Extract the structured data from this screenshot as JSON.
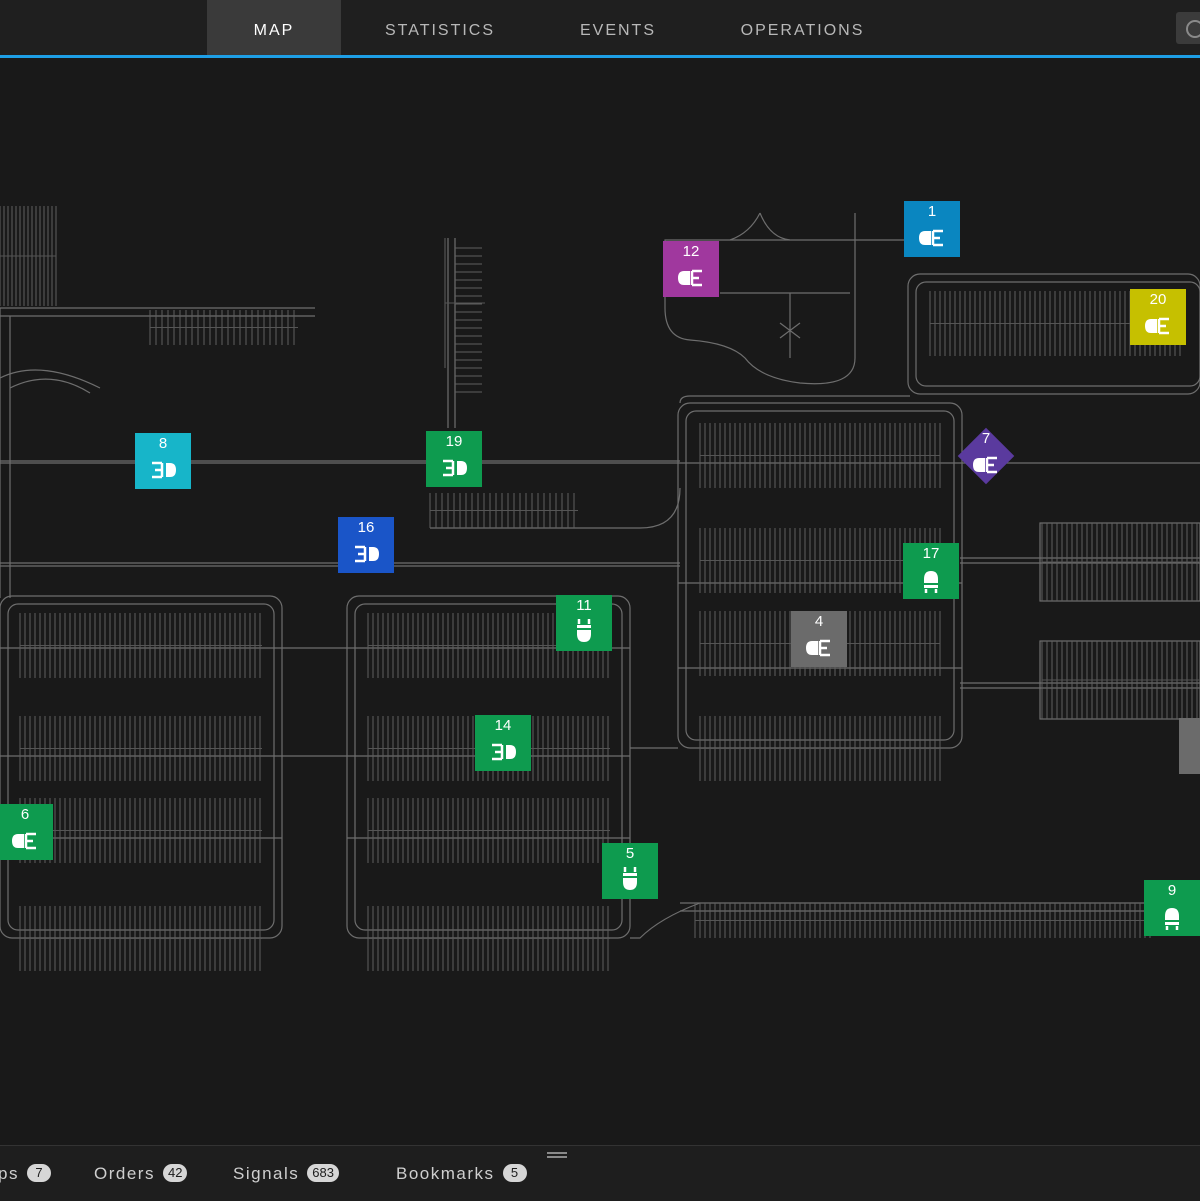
{
  "tabs": [
    {
      "label": "MAP",
      "active": true
    },
    {
      "label": "STATISTICS",
      "active": false
    },
    {
      "label": "EVENTS",
      "active": false
    },
    {
      "label": "OPERATIONS",
      "active": false
    }
  ],
  "colors": {
    "accent": "#1e9fe6",
    "green": "#0e9b4f",
    "cyan": "#17b5c9",
    "teal_blue": "#0a86c0",
    "blue": "#1a55c8",
    "magenta": "#a0389e",
    "yellow": "#c6c000",
    "purple": "#5a3a9e",
    "gray": "#6b6b6b"
  },
  "vehicles": [
    {
      "number": "1",
      "color": "#0a86c0",
      "icon": "agv-forward-icon"
    },
    {
      "number": "12",
      "color": "#a0389e",
      "icon": "agv-forward-icon"
    },
    {
      "number": "20",
      "color": "#c6c000",
      "icon": "agv-forward-icon"
    },
    {
      "number": "8",
      "color": "#17b5c9",
      "icon": "agv-reverse-icon"
    },
    {
      "number": "19",
      "color": "#0e9b4f",
      "icon": "agv-reverse-icon"
    },
    {
      "number": "7",
      "color": "#5a3a9e",
      "icon": "agv-forward-icon"
    },
    {
      "number": "16",
      "color": "#1a55c8",
      "icon": "agv-reverse-icon"
    },
    {
      "number": "17",
      "color": "#0e9b4f",
      "icon": "agv-up-icon"
    },
    {
      "number": "11",
      "color": "#0e9b4f",
      "icon": "agv-down-icon"
    },
    {
      "number": "4",
      "color": "#6b6b6b",
      "icon": "agv-forward-icon"
    },
    {
      "number": "14",
      "color": "#0e9b4f",
      "icon": "agv-reverse-icon"
    },
    {
      "number": "6",
      "color": "#0e9b4f",
      "icon": "agv-forward-icon"
    },
    {
      "number": "5",
      "color": "#0e9b4f",
      "icon": "agv-down-icon"
    },
    {
      "number": "9",
      "color": "#0e9b4f",
      "icon": "agv-up-icon"
    }
  ],
  "bottom_tabs": [
    {
      "label": "ps",
      "count": "7"
    },
    {
      "label": "Orders",
      "count": "42"
    },
    {
      "label": "Signals",
      "count": "683"
    },
    {
      "label": "Bookmarks",
      "count": "5"
    }
  ]
}
